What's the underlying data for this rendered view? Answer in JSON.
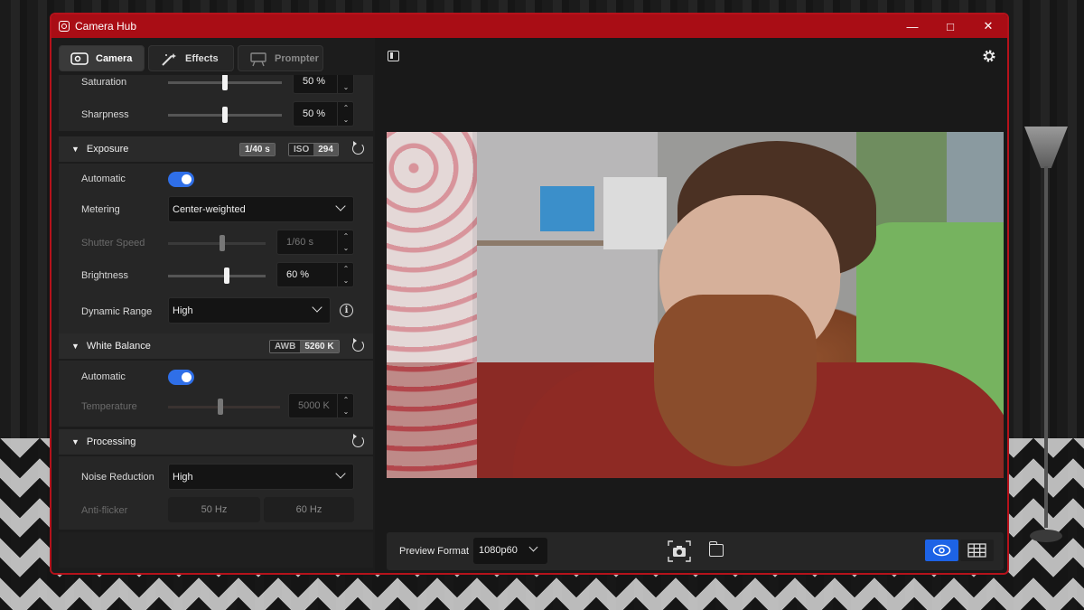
{
  "window": {
    "title": "Camera Hub"
  },
  "tabs": [
    {
      "label": "Camera",
      "icon": "camera-icon",
      "state": "active"
    },
    {
      "label": "Effects",
      "icon": "magic-wand-icon",
      "state": "normal"
    },
    {
      "label": "Prompter",
      "icon": "prompter-icon",
      "state": "disabled"
    }
  ],
  "image_settings": {
    "saturation": {
      "label": "Saturation",
      "value": "50 %",
      "level": 0.5
    },
    "sharpness": {
      "label": "Sharpness",
      "value": "50 %",
      "level": 0.5
    }
  },
  "exposure": {
    "title": "Exposure",
    "badge_shutter": "1/40 s",
    "badge_iso_key": "ISO",
    "badge_iso_value": "294",
    "automatic_label": "Automatic",
    "automatic_on": true,
    "metering_label": "Metering",
    "metering_value": "Center-weighted",
    "shutter_label": "Shutter Speed",
    "shutter_value": "1/60 s",
    "brightness_label": "Brightness",
    "brightness_value": "60 %",
    "brightness_level": 0.6,
    "dynamic_range_label": "Dynamic Range",
    "dynamic_range_value": "High"
  },
  "white_balance": {
    "title": "White Balance",
    "badge_key": "AWB",
    "badge_value": "5260 K",
    "automatic_label": "Automatic",
    "automatic_on": true,
    "temperature_label": "Temperature",
    "temperature_value": "5000 K"
  },
  "processing": {
    "title": "Processing",
    "noise_reduction_label": "Noise Reduction",
    "noise_reduction_value": "High",
    "anti_flicker_label": "Anti-flicker",
    "anti_flicker_options": [
      "50 Hz",
      "60 Hz"
    ]
  },
  "bottombar": {
    "preview_format_label": "Preview Format",
    "preview_format_value": "1080p60"
  },
  "colors": {
    "accent": "#1d63e6",
    "titlebar": "#a90d15"
  }
}
